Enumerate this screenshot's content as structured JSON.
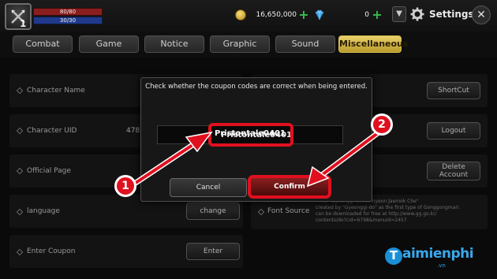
{
  "player": {
    "level": "1",
    "hp": "80/80",
    "mp": "30/30"
  },
  "currency": {
    "gold": "16,650,000",
    "gems": "0"
  },
  "header": {
    "title": "Settings",
    "dropdown_icon": "chevron-down",
    "gear_icon": "gear",
    "close_icon": "close"
  },
  "tabs": [
    {
      "label": "Combat"
    },
    {
      "label": "Game"
    },
    {
      "label": "Notice"
    },
    {
      "label": "Graphic"
    },
    {
      "label": "Sound"
    },
    {
      "label": "Miscellaneous",
      "active": true
    }
  ],
  "rows": {
    "character_name": {
      "label": "Character Name",
      "button": "ShortCut"
    },
    "character_uid": {
      "label": "Character UID",
      "value": "478",
      "button": "Logout"
    },
    "official_page": {
      "label": "Official Page",
      "button_line1": "Delete",
      "button_line2": "Account"
    },
    "language": {
      "label": "language",
      "button": "change"
    },
    "font_source": {
      "label": "Font Source",
      "lines": [
        "The \"Gyeonggi Cheon-nyeon Jaemok Che\"",
        "created by \"Gyeonggi-do\" as the first type of Gonggongmari.",
        "can be downloaded for free at http://www.gg.go.kr/",
        "contents/do?cid=6798&menuId=2457"
      ]
    },
    "enter_coupon": {
      "label": "Enter Coupon",
      "button": "Enter"
    }
  },
  "dialog": {
    "message": "Check whether the coupon codes are correct when being entered.",
    "input_value": "Pristontale0401",
    "cancel_label": "Cancel",
    "confirm_label": "Confirm"
  },
  "annotations": {
    "badge1": "1",
    "badge2": "2",
    "color": "#e0101f"
  },
  "watermark": {
    "initial": "T",
    "text": "aimienphi",
    "sub": ".vn"
  }
}
